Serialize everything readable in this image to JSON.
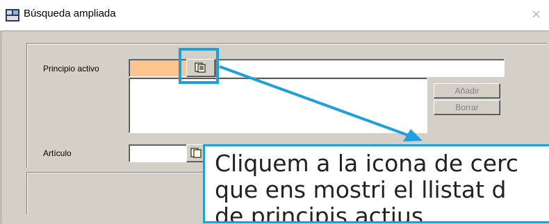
{
  "window": {
    "title": "Búsqueda ampliada",
    "app_icon": "database-app-icon",
    "close_icon": "close-icon",
    "close_glyph": "×"
  },
  "form": {
    "principio_activo_label": "Principio activo",
    "principio_activo_value": "",
    "principio_activo_description": "",
    "anadir_label": "Añadir",
    "borrar_label": "Borrar",
    "articulo_label": "Artículo",
    "articulo_value": "",
    "search_icon": "search-list-icon"
  },
  "callout": {
    "line1": "Cliquem a la icona de cerc",
    "line2": "que ens mostri el llistat d",
    "line3": "de principis actius",
    "accent_color": "#1ea0dc"
  }
}
